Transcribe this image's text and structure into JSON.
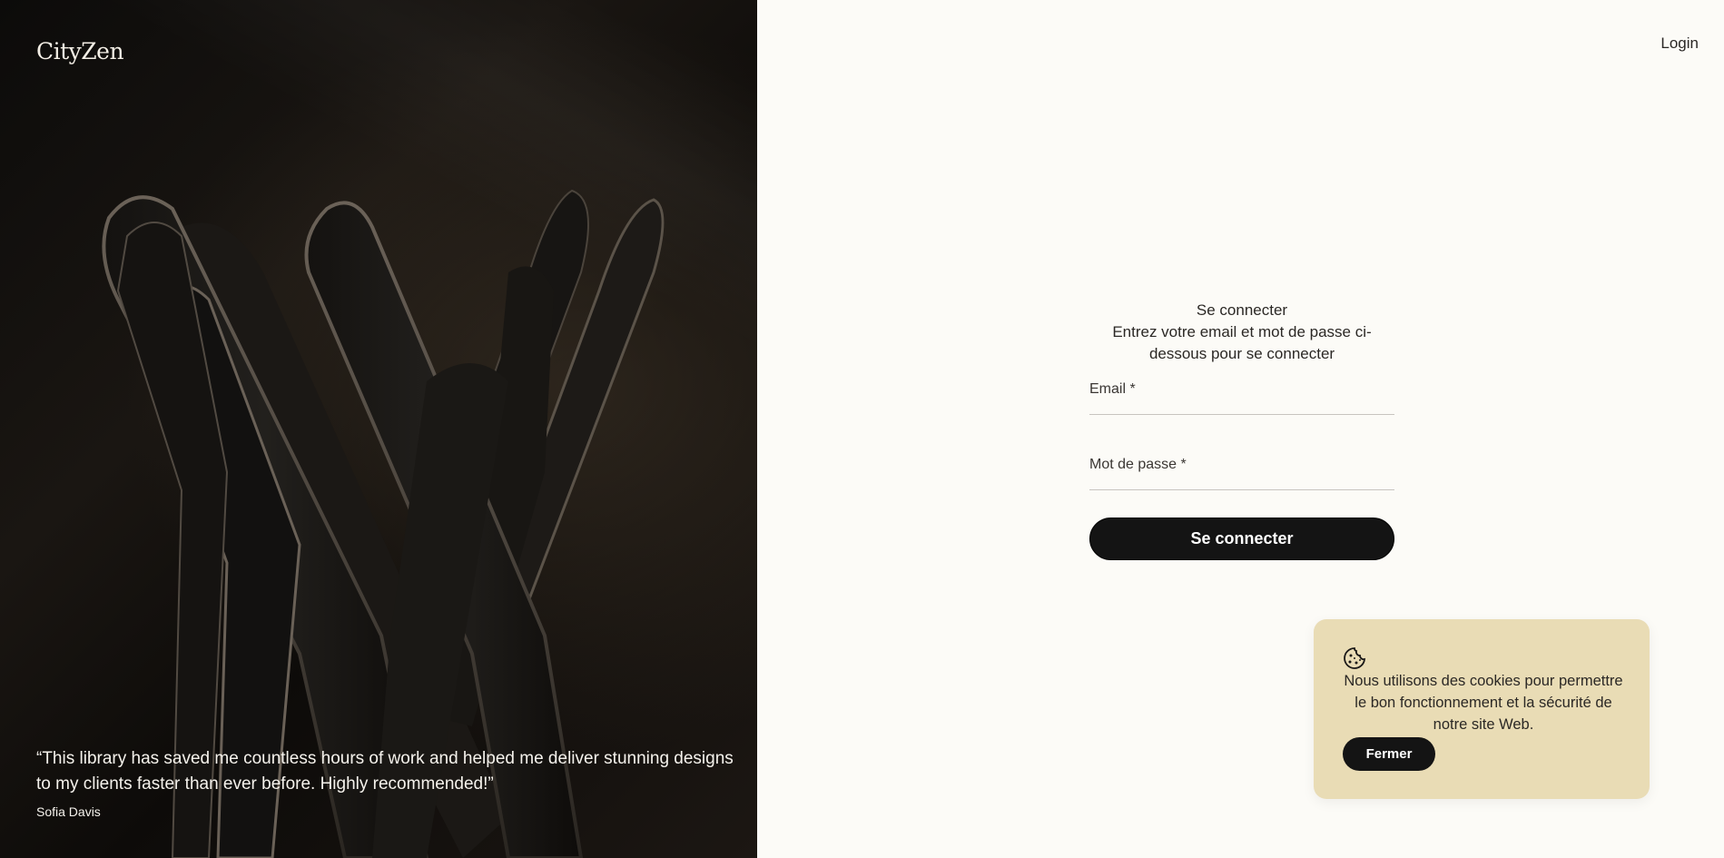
{
  "brand": {
    "logo": "CityZen"
  },
  "testimonial": {
    "quote": "“This library has saved me countless hours of work and helped me deliver stunning designs to my clients faster than ever before. Highly recommended!”",
    "author": "Sofia Davis"
  },
  "header": {
    "login_link": "Login"
  },
  "login_form": {
    "title": "Se connecter",
    "subtitle": "Entrez votre email et mot de passe ci-dessous pour se connecter",
    "email_label": "Email *",
    "email_value": "",
    "password_label": "Mot de passe *",
    "password_value": "",
    "submit_label": "Se connecter"
  },
  "cookie_banner": {
    "icon": "cookie-icon",
    "message": "Nous utilisons des cookies pour permettre le bon fonctionnement et la sécurité de notre site Web.",
    "close_label": "Fermer"
  },
  "colors": {
    "left_panel_bg": "#0f0d0b",
    "page_bg": "#fcfbf7",
    "button_bg": "#141414",
    "cookie_bg": "#e9dcb5"
  }
}
